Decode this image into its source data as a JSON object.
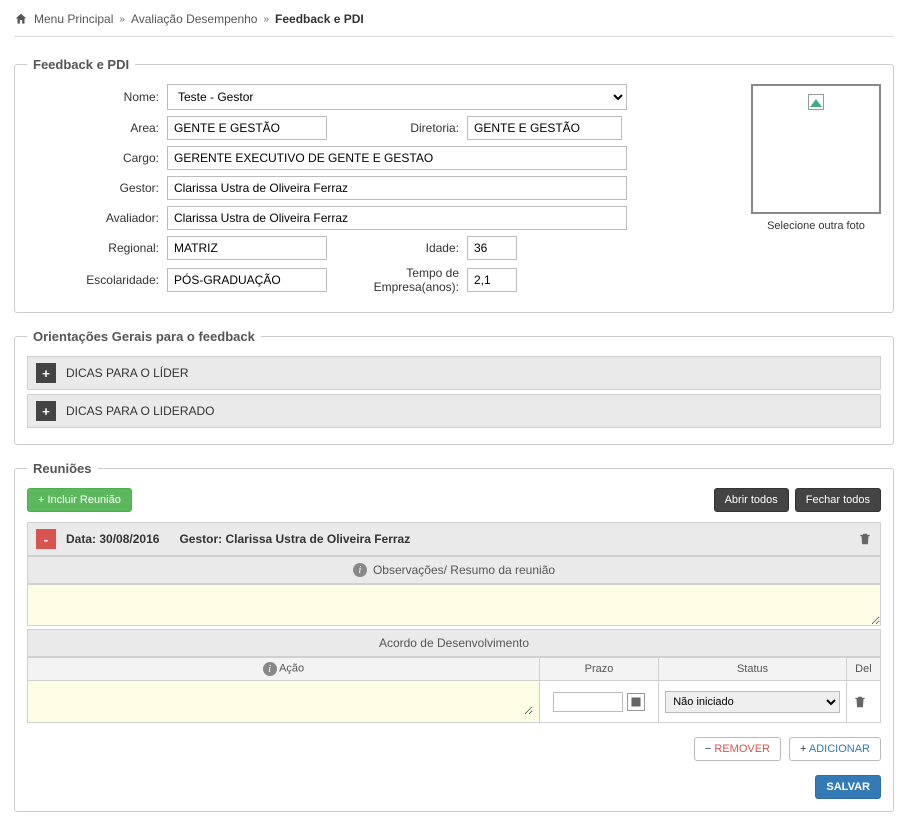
{
  "breadcrumb": {
    "home": "Menu Principal",
    "mid": "Avaliação Desempenho",
    "current": "Feedback e PDI"
  },
  "profile": {
    "legend": "Feedback e PDI",
    "labels": {
      "nome": "Nome:",
      "area": "Area:",
      "diretoria": "Diretoria:",
      "cargo": "Cargo:",
      "gestor": "Gestor:",
      "avaliador": "Avaliador:",
      "regional": "Regional:",
      "idade": "Idade:",
      "escolaridade": "Escolaridade:",
      "tempo": "Tempo de Empresa(anos):"
    },
    "values": {
      "nome": "Teste - Gestor",
      "area": "GENTE E GESTÃO",
      "diretoria": "GENTE E GESTÃO",
      "cargo": "GERENTE EXECUTIVO DE GENTE E GESTAO",
      "gestor": "Clarissa Ustra de Oliveira Ferraz",
      "avaliador": "Clarissa Ustra de Oliveira Ferraz",
      "regional": "MATRIZ",
      "idade": "36",
      "escolaridade": "PÓS-GRADUAÇÃO",
      "tempo": "2,1"
    },
    "photo_caption": "Selecione outra foto"
  },
  "guidance": {
    "legend": "Orientações Gerais para o feedback",
    "items": [
      {
        "label": "DICAS PARA O LÍDER"
      },
      {
        "label": "DICAS PARA O LIDERADO"
      }
    ]
  },
  "meetings": {
    "legend": "Reuniões",
    "buttons": {
      "add": "+ Incluir Reunião",
      "open_all": "Abrir todos",
      "close_all": "Fechar todos"
    },
    "item": {
      "date_label": "Data:",
      "date": "30/08/2016",
      "gestor_label": "Gestor:",
      "gestor": "Clarissa Ustra de Oliveira Ferraz"
    },
    "obs_title": "Observações/ Resumo da reunião",
    "dev_title": "Acordo de Desenvolvimento",
    "dev_headers": {
      "acao": "Ação",
      "prazo": "Prazo",
      "status": "Status",
      "del": "Del"
    },
    "dev_row": {
      "status": "Não iniciado"
    },
    "actions": {
      "remove": "REMOVER",
      "add": "ADICIONAR",
      "save": "SALVAR"
    }
  }
}
